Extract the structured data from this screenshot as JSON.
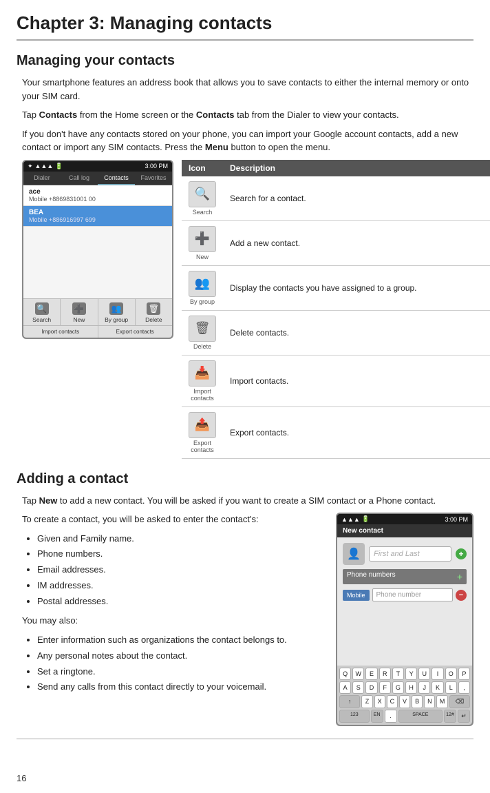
{
  "chapter": {
    "title": "Chapter 3: Managing contacts"
  },
  "managing_section": {
    "title": "Managing your contacts",
    "paragraphs": [
      "Your smartphone features an address book that allows you to save contacts to either the internal memory or onto your SIM card.",
      "Tap Contacts from the Home screen or the Contacts tab from the Dialer to view your contacts.",
      "If you don't have any contacts stored on your phone, you can import your Google account contacts, add a new contact or import any SIM contacts. Press the Menu button to open the menu."
    ]
  },
  "phone1": {
    "statusbar_time": "3:00 PM",
    "tabs": [
      "Dialer",
      "Call log",
      "Contacts",
      "Favorites"
    ],
    "active_tab": "Contacts",
    "contacts": [
      {
        "name": "ace",
        "number": "Mobile +8869831001 00"
      },
      {
        "name": "BEA",
        "number": "Mobile +886916997 699",
        "highlighted": true
      }
    ],
    "actions": [
      "Search",
      "New",
      "By group",
      "Delete"
    ],
    "import_actions": [
      "Import contacts",
      "Export contacts"
    ]
  },
  "icon_table": {
    "col_icon": "Icon",
    "col_desc": "Description",
    "rows": [
      {
        "icon": "🔍",
        "icon_label": "Search",
        "description": "Search for a contact."
      },
      {
        "icon": "➕",
        "icon_label": "New",
        "description": "Add a new contact."
      },
      {
        "icon": "👥",
        "icon_label": "By group",
        "description": "Display the contacts you have assigned to a group."
      },
      {
        "icon": "🗑",
        "icon_label": "Delete",
        "description": "Delete contacts."
      },
      {
        "icon": "📥",
        "icon_label": "Import contacts",
        "description": "Import contacts."
      },
      {
        "icon": "📤",
        "icon_label": "Export contacts",
        "description": "Export contacts."
      }
    ]
  },
  "adding_section": {
    "title": "Adding a contact",
    "intro": "Tap New to add a new contact. You will be asked if you want to create a SIM contact or a Phone contact.",
    "sub_intro": "To create a contact, you will be asked to enter the contact's:",
    "bullet1": [
      "Given and Family name.",
      "Phone numbers.",
      "Email addresses.",
      "IM addresses.",
      "Postal addresses."
    ],
    "you_may_also": "You may also:",
    "bullet2": [
      "Enter information such as organizations the contact belongs to.",
      "Any personal notes about the contact.",
      "Set a ringtone.",
      "Send any calls from this contact directly to your voicemail."
    ]
  },
  "phone2": {
    "statusbar_time": "3:00 PM",
    "header": "New contact",
    "name_placeholder": "First and Last",
    "section_phone": "Phone numbers",
    "phone_type": "Mobile",
    "phone_placeholder": "Phone number",
    "keyboard": {
      "row1": [
        "Q",
        "W",
        "E",
        "R",
        "T",
        "Y",
        "U",
        "I",
        "O",
        "P"
      ],
      "row2": [
        "A",
        "S",
        "D",
        "F",
        "G",
        "H",
        "J",
        "K",
        "L",
        ","
      ],
      "row3": [
        "↑",
        "Z",
        "X",
        "C",
        "V",
        "B",
        "N",
        "M",
        "⌫"
      ],
      "row4_special": [
        "123",
        "EN",
        ".",
        "SPACE",
        "12#",
        "↵"
      ]
    }
  },
  "page_number": "16"
}
